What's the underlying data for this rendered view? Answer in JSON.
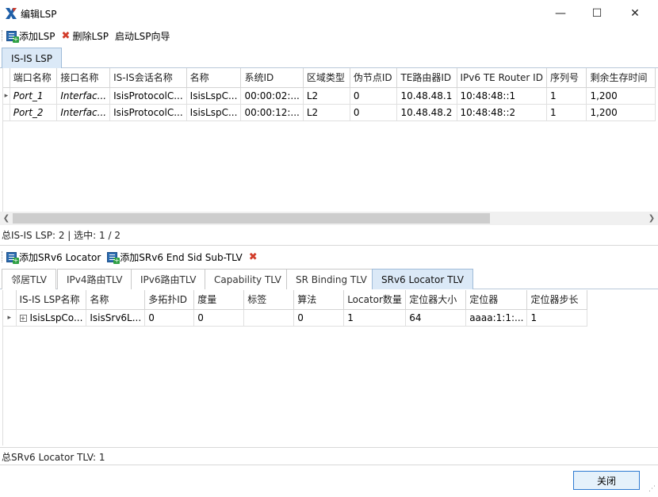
{
  "window": {
    "title": "编辑LSP",
    "minimize": "—",
    "maximize": "☐",
    "close": "✕"
  },
  "toolbar": {
    "add_lsp": "添加LSP",
    "delete_lsp": "删除LSP",
    "start_wizard": "启动LSP向导"
  },
  "top_tabs": [
    "IS-IS LSP"
  ],
  "lsp_grid": {
    "columns": [
      "端口名称",
      "接口名称",
      "IS-IS会话名称",
      "名称",
      "系统ID",
      "区域类型",
      "伪节点ID",
      "TE路由器ID",
      "IPv6 TE Router ID",
      "序列号",
      "剩余生存时间"
    ],
    "rows": [
      [
        "Port_1",
        "Interfac...",
        "IsisProtocolC...",
        "IsisLspC...",
        "00:00:02:...",
        "L2",
        "0",
        "10.48.48.1",
        "10:48:48::1",
        "1",
        "1,200"
      ],
      [
        "Port_2",
        "Interfac...",
        "IsisProtocolC...",
        "IsisLspC...",
        "00:00:12:...",
        "L2",
        "0",
        "10.48.48.2",
        "10:48:48::2",
        "1",
        "1,200"
      ]
    ]
  },
  "lsp_status": "总IS-IS LSP: 2 | 选中: 1 / 2",
  "toolbar2": {
    "add_locator": "添加SRv6 Locator",
    "add_end_sid": "添加SRv6 End Sid Sub-TLV"
  },
  "bottom_tabs": [
    "邻居TLV",
    "IPv4路由TLV",
    "IPv6路由TLV",
    "Capability TLV",
    "SR Binding TLV",
    "SRv6 Locator TLV"
  ],
  "locator_grid": {
    "columns": [
      "IS-IS LSP名称",
      "名称",
      "多拓扑ID",
      "度量",
      "标签",
      "算法",
      "Locator数量",
      "定位器大小",
      "定位器",
      "定位器步长"
    ],
    "rows": [
      [
        "IsisLspCo...",
        "IsisSrv6L...",
        "0",
        "0",
        "",
        "0",
        "1",
        "64",
        "aaaa:1:1:...",
        "1"
      ]
    ]
  },
  "locator_status": "总SRv6 Locator TLV: 1",
  "close_button": "关闭",
  "colors": {
    "active_tab": "#dbe9f7",
    "add_icon": "#2b6cb0",
    "delete_icon": "#d23c2a",
    "app_icon": "#1f5fa8"
  }
}
